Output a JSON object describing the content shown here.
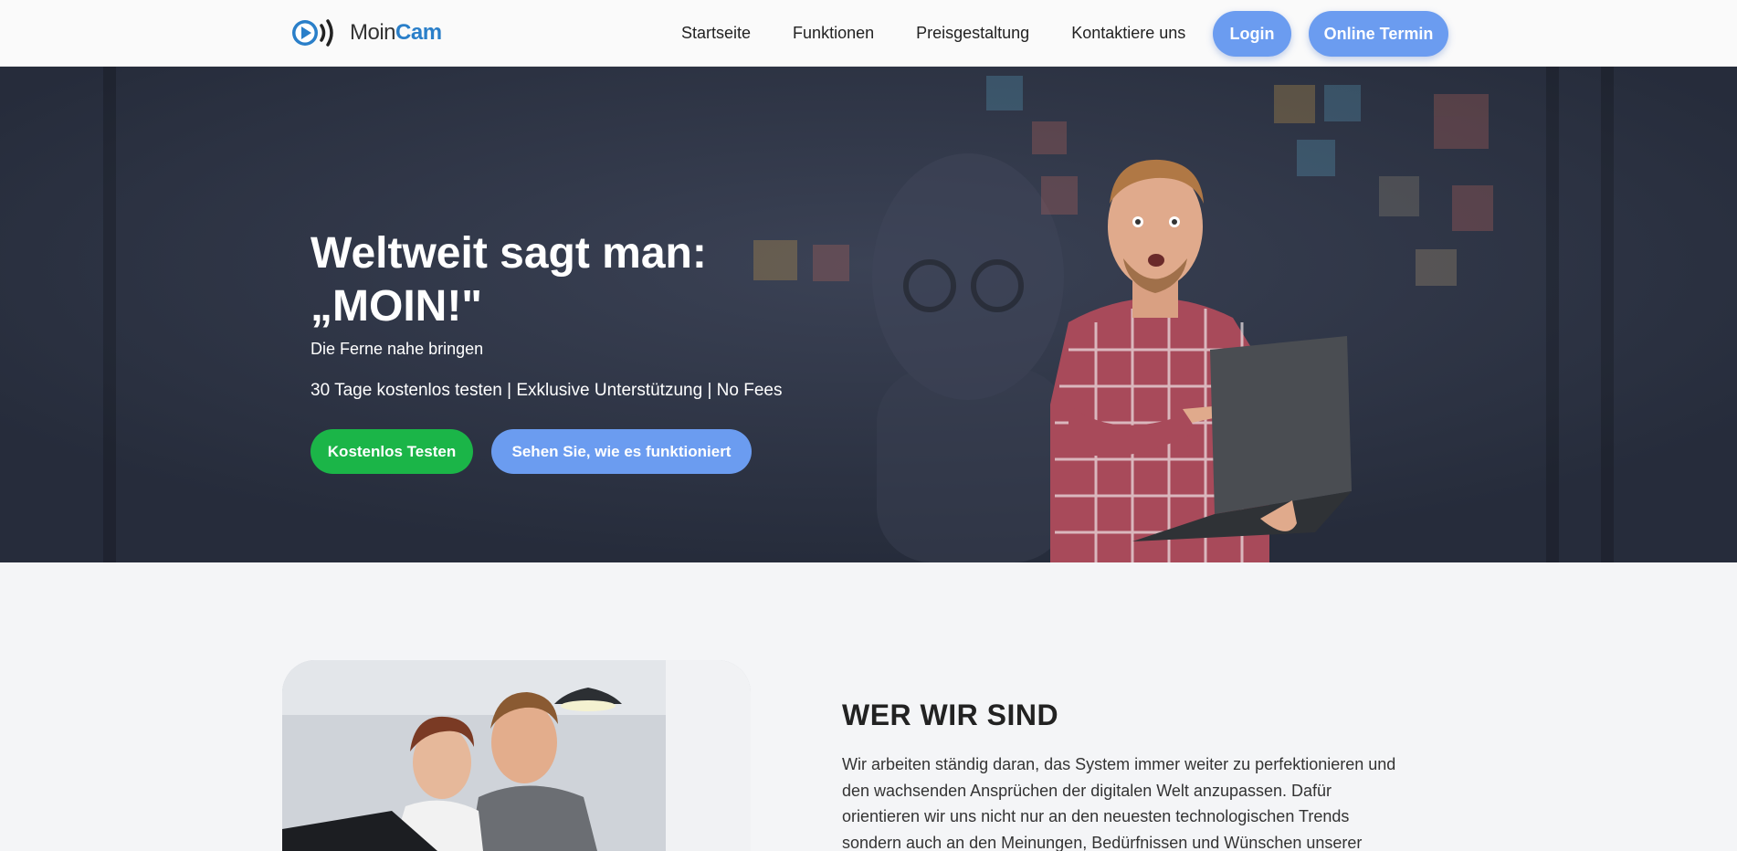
{
  "brand": {
    "name_part1": "Moin",
    "name_part2": "Cam",
    "accent": "#2a7fc9"
  },
  "nav": {
    "links": [
      "Startseite",
      "Funktionen",
      "Preisgestaltung",
      "Kontaktiere uns"
    ],
    "login_label": "Login",
    "termin_label": "Online Termin",
    "button_color": "#6b9cf0"
  },
  "hero": {
    "title": "Weltweit sagt man: „MOIN!\"",
    "subtitle": "Die Ferne nahe bringen",
    "tagline": "30 Tage kostenlos testen | Exklusive Unterstützung | No Fees",
    "cta_primary": "Kostenlos Testen",
    "cta_secondary": "Sehen Sie, wie es funktioniert",
    "cta_primary_color": "#1bb548",
    "background_color": "#2d3446"
  },
  "about": {
    "title": "WER WIR SIND",
    "text": "Wir arbeiten ständig daran, das System immer weiter zu perfektionieren und den wachsenden Ansprüchen der digitalen Welt anzupassen. Dafür orientieren wir uns nicht nur an den neuesten technologischen Trends sondern auch an den Meinungen, Bedürfnissen und Wünschen unserer"
  },
  "icons": {
    "logo": "play-signal-icon"
  }
}
